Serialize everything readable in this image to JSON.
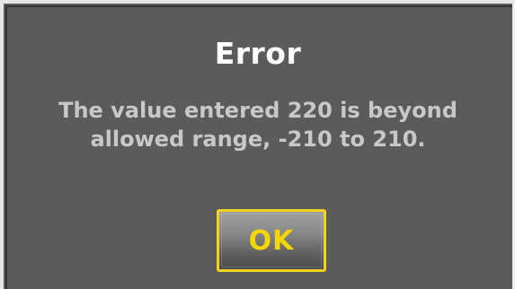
{
  "dialog": {
    "title": "Error",
    "message_line1": "The value entered 220 is beyond",
    "message_line2": "allowed range, -210 to 210.",
    "ok_label": "OK"
  },
  "colors": {
    "background": "#5b5b5b",
    "title": "#ffffff",
    "message": "#c8c8c8",
    "button_border": "#f2d21a",
    "button_text": "#f4d600"
  }
}
